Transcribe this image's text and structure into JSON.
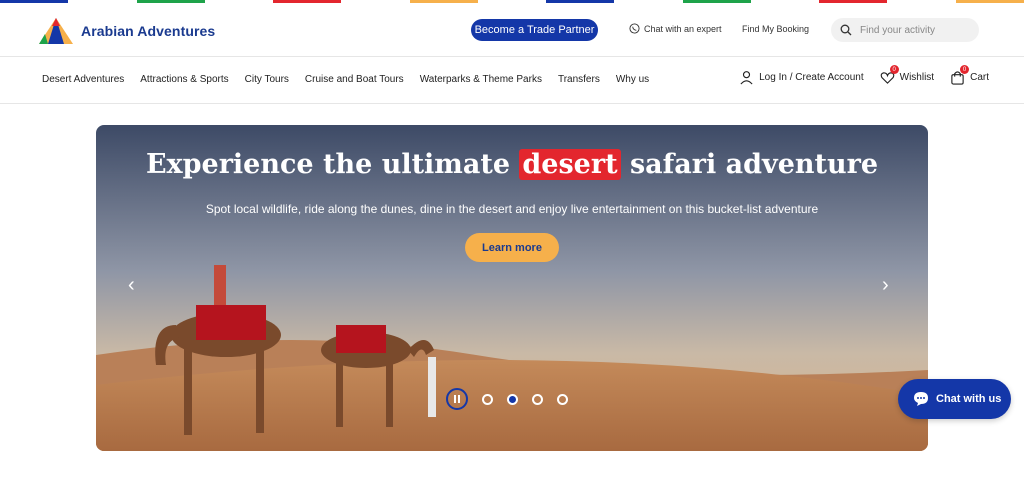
{
  "colors": {
    "brand_blue": "#1437a8",
    "accent_orange": "#f6b04b",
    "highlight_red": "#e3262e",
    "stripe": [
      "#1437a8",
      "#e3262e",
      "#1ea34a",
      "#f6b04b"
    ]
  },
  "header": {
    "logo_text": "Arabian Adventures",
    "trade_partner_label": "Become a Trade Partner",
    "chat_expert_label": "Chat with an expert",
    "find_booking_label": "Find My Booking",
    "search_placeholder": "Find your activity"
  },
  "nav": {
    "items": [
      "Desert Adventures",
      "Attractions & Sports",
      "City Tours",
      "Cruise and Boat Tours",
      "Waterparks & Theme Parks",
      "Transfers",
      "Why us"
    ],
    "login_label": "Log In / Create Account",
    "wishlist_label": "Wishlist",
    "wishlist_count": "0",
    "cart_label": "Cart",
    "cart_count": "0"
  },
  "hero": {
    "title_pre": "Experience the ultimate ",
    "title_highlight": "desert",
    "title_post": " safari adventure",
    "subtitle": "Spot local wildlife, ride along the dunes, dine in the desert and enjoy live entertainment on this bucket-list adventure",
    "cta_label": "Learn more",
    "prev_arrow": "‹",
    "next_arrow": "›",
    "slide_count": 4,
    "active_slide": 2
  },
  "chat_widget": {
    "label": "Chat with us"
  }
}
